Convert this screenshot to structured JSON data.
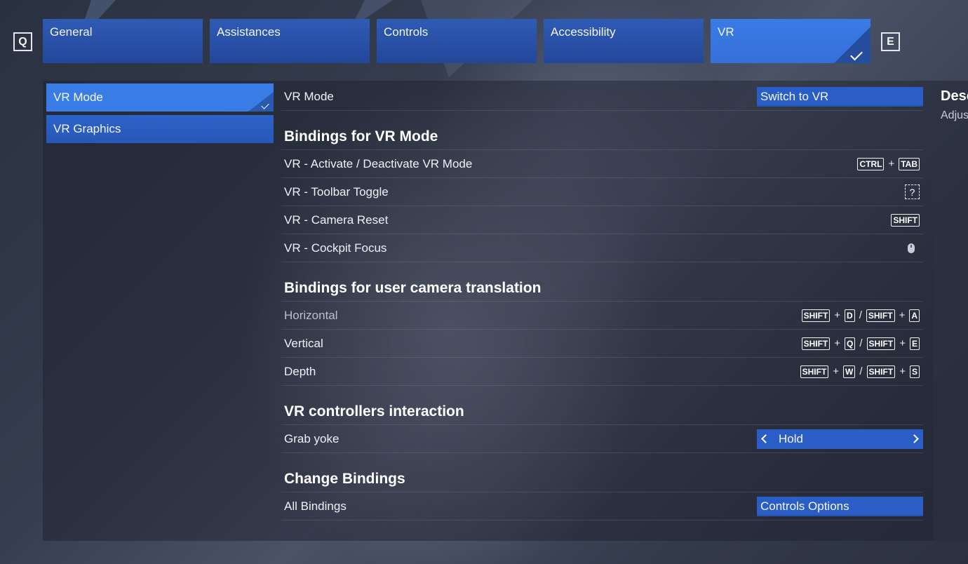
{
  "nav": {
    "prev_key": "Q",
    "next_key": "E",
    "tabs": [
      {
        "label": "General"
      },
      {
        "label": "Assistances"
      },
      {
        "label": "Controls"
      },
      {
        "label": "Accessibility"
      },
      {
        "label": "VR"
      }
    ]
  },
  "sidebar": {
    "items": [
      {
        "label": "VR Mode"
      },
      {
        "label": "VR Graphics"
      }
    ]
  },
  "content": {
    "vr_mode": {
      "label": "VR Mode",
      "button": "Switch to VR"
    },
    "sections": {
      "vr_bindings": "Bindings for VR Mode",
      "camera_translation": "Bindings for user camera translation",
      "controllers": "VR controllers interaction",
      "change_bindings": "Change Bindings"
    },
    "vr_rows": [
      {
        "label": "VR - Activate / Deactivate VR Mode",
        "keys": [
          "CTRL",
          "TAB"
        ],
        "joiner": "+"
      },
      {
        "label": "VR - Toolbar Toggle",
        "unknown": "?"
      },
      {
        "label": "VR - Camera Reset",
        "keys": [
          "SHIFT"
        ]
      },
      {
        "label": "VR - Cockpit Focus",
        "icon": "mouse-icon"
      }
    ],
    "camera_rows": [
      {
        "label": "Horizontal",
        "combo": [
          "SHIFT",
          "D",
          "SHIFT",
          "A"
        ]
      },
      {
        "label": "Vertical",
        "combo": [
          "SHIFT",
          "Q",
          "SHIFT",
          "E"
        ]
      },
      {
        "label": "Depth",
        "combo": [
          "SHIFT",
          "W",
          "SHIFT",
          "S"
        ]
      }
    ],
    "plus": "+",
    "slash": "/",
    "grab_yoke": {
      "label": "Grab yoke",
      "value": "Hold"
    },
    "all_bindings": {
      "label": "All Bindings",
      "button": "Controls Options"
    }
  },
  "description_panel": {
    "title": "Desc",
    "subtitle": "Adjus"
  },
  "colors": {
    "accent": "#3a7ce6",
    "tab": "#2a52a8",
    "button": "#2a5ec6"
  }
}
